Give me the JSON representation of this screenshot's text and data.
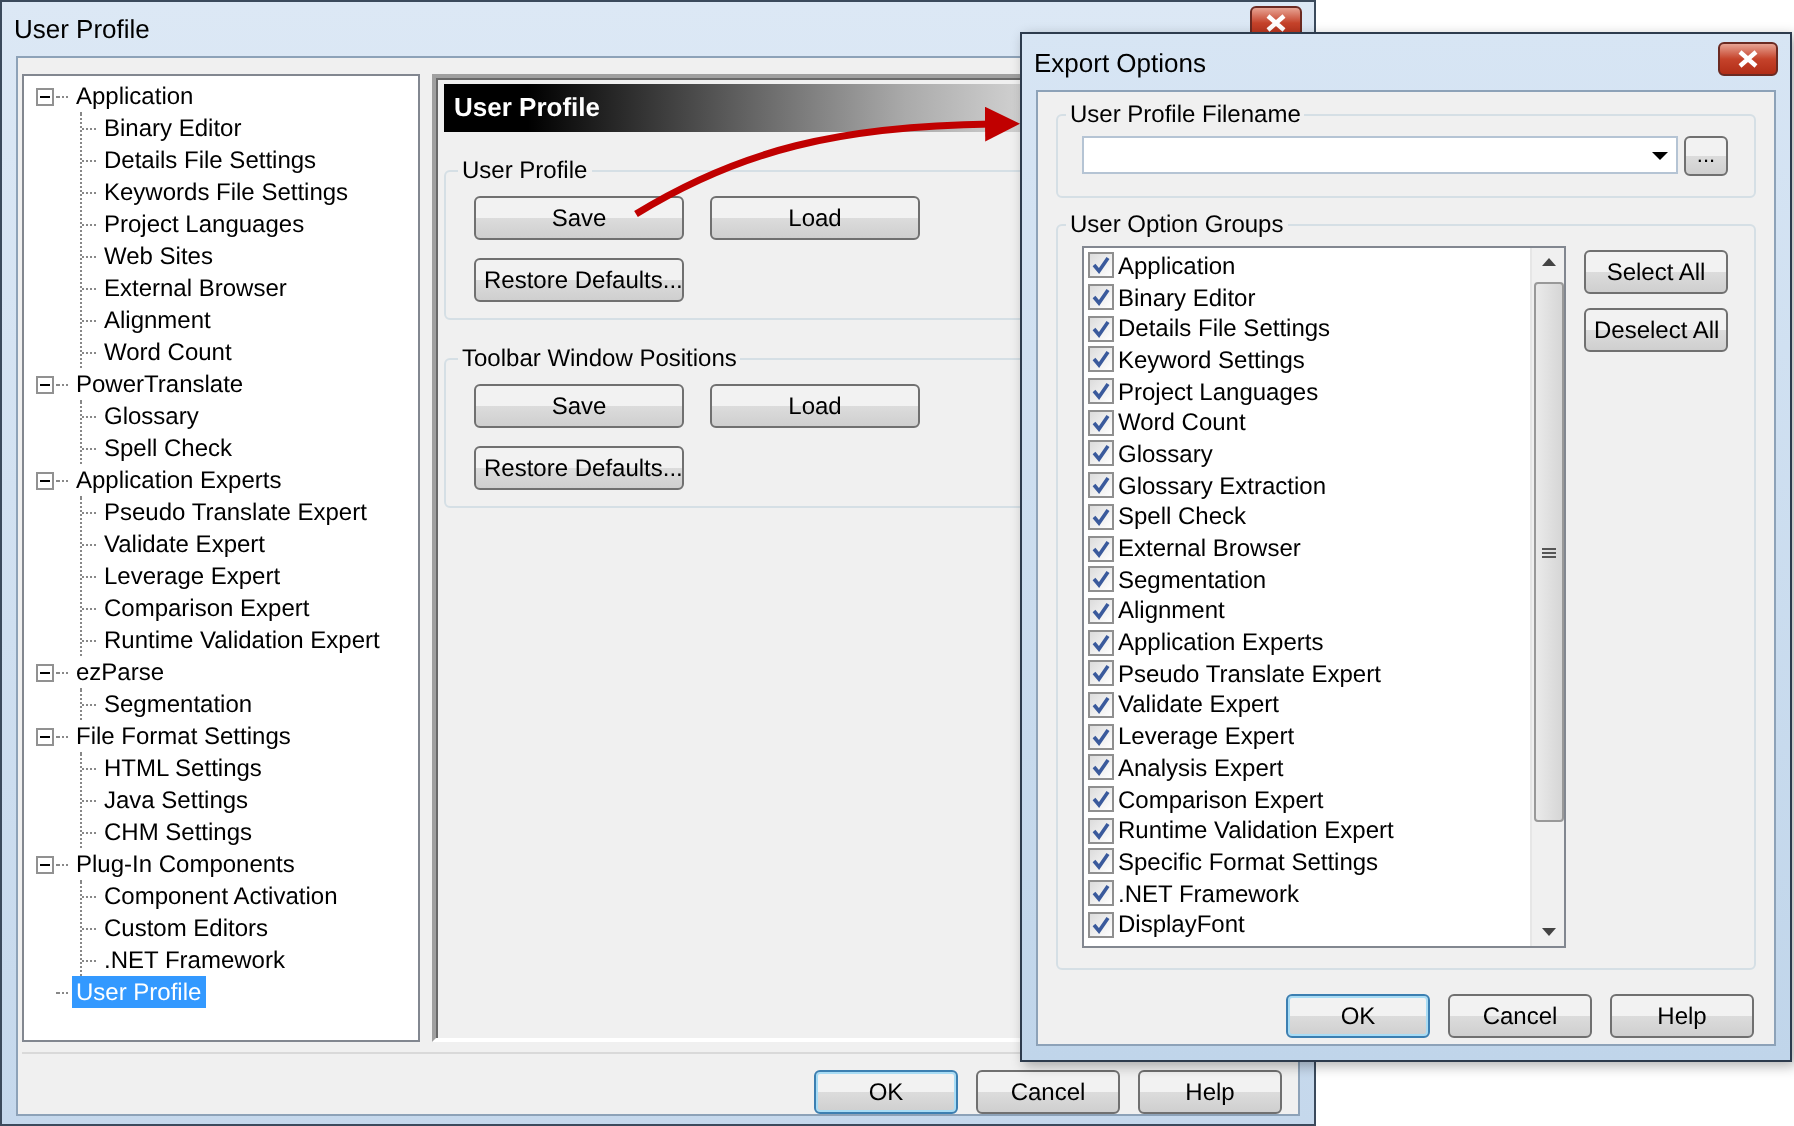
{
  "window": {
    "title": "User Profile"
  },
  "tree": [
    {
      "label": "Application",
      "expanded": true,
      "selected": false,
      "children": [
        {
          "label": "Binary Editor",
          "selected": false
        },
        {
          "label": "Details File Settings",
          "selected": false
        },
        {
          "label": "Keywords File Settings",
          "selected": false
        },
        {
          "label": "Project Languages",
          "selected": false
        },
        {
          "label": "Web Sites",
          "selected": false
        },
        {
          "label": "External Browser",
          "selected": false
        },
        {
          "label": "Alignment",
          "selected": false
        },
        {
          "label": "Word Count",
          "selected": false
        }
      ]
    },
    {
      "label": "PowerTranslate",
      "expanded": true,
      "selected": false,
      "children": [
        {
          "label": "Glossary",
          "selected": false
        },
        {
          "label": "Spell Check",
          "selected": false
        }
      ]
    },
    {
      "label": "Application Experts",
      "expanded": true,
      "selected": false,
      "children": [
        {
          "label": "Pseudo Translate Expert",
          "selected": false
        },
        {
          "label": "Validate Expert",
          "selected": false
        },
        {
          "label": "Leverage Expert",
          "selected": false
        },
        {
          "label": "Comparison Expert",
          "selected": false
        },
        {
          "label": "Runtime Validation Expert",
          "selected": false
        }
      ]
    },
    {
      "label": "ezParse",
      "expanded": true,
      "selected": false,
      "children": [
        {
          "label": "Segmentation",
          "selected": false
        }
      ]
    },
    {
      "label": "File Format Settings",
      "expanded": true,
      "selected": false,
      "children": [
        {
          "label": "HTML Settings",
          "selected": false
        },
        {
          "label": "Java Settings",
          "selected": false
        },
        {
          "label": "CHM Settings",
          "selected": false
        }
      ]
    },
    {
      "label": "Plug-In Components",
      "expanded": true,
      "selected": false,
      "children": [
        {
          "label": "Component Activation",
          "selected": false
        },
        {
          "label": "Custom Editors",
          "selected": false
        },
        {
          "label": ".NET Framework",
          "selected": false
        }
      ]
    },
    {
      "label": "User Profile",
      "selected": true
    }
  ],
  "panel": {
    "heading": "User Profile",
    "groups": [
      {
        "title": "User Profile",
        "buttons": [
          "Save",
          "Load"
        ],
        "restore": "Restore Defaults..."
      },
      {
        "title": "Toolbar Window Positions",
        "buttons": [
          "Save",
          "Load"
        ],
        "restore": "Restore Defaults..."
      }
    ]
  },
  "footer_buttons": [
    {
      "label": "OK",
      "default": true
    },
    {
      "label": "Cancel",
      "default": false
    },
    {
      "label": "Help",
      "default": false
    }
  ],
  "dialog": {
    "title": "Export Options",
    "filename_group": "User Profile Filename",
    "browse": "...",
    "options_group": "User Option Groups",
    "options": [
      {
        "label": "Application",
        "checked": true
      },
      {
        "label": "Binary Editor",
        "checked": true
      },
      {
        "label": "Details File Settings",
        "checked": true
      },
      {
        "label": "Keyword Settings",
        "checked": true
      },
      {
        "label": "Project Languages",
        "checked": true
      },
      {
        "label": "Word Count",
        "checked": true
      },
      {
        "label": "Glossary",
        "checked": true
      },
      {
        "label": "Glossary Extraction",
        "checked": true
      },
      {
        "label": "Spell Check",
        "checked": true
      },
      {
        "label": "External Browser",
        "checked": true
      },
      {
        "label": "Segmentation",
        "checked": true
      },
      {
        "label": "Alignment",
        "checked": true
      },
      {
        "label": "Application Experts",
        "checked": true
      },
      {
        "label": "Pseudo Translate Expert",
        "checked": true
      },
      {
        "label": "Validate Expert",
        "checked": true
      },
      {
        "label": "Leverage Expert",
        "checked": true
      },
      {
        "label": "Analysis Expert",
        "checked": true
      },
      {
        "label": "Comparison Expert",
        "checked": true
      },
      {
        "label": "Runtime Validation Expert",
        "checked": true
      },
      {
        "label": "Specific Format Settings",
        "checked": true
      },
      {
        "label": ".NET Framework",
        "checked": true
      },
      {
        "label": "DisplayFont",
        "checked": true
      }
    ],
    "side_buttons": [
      "Select All",
      "Deselect All"
    ],
    "footer_buttons": [
      {
        "label": "OK",
        "default": true
      },
      {
        "label": "Cancel",
        "default": false
      },
      {
        "label": "Help",
        "default": false
      }
    ]
  }
}
